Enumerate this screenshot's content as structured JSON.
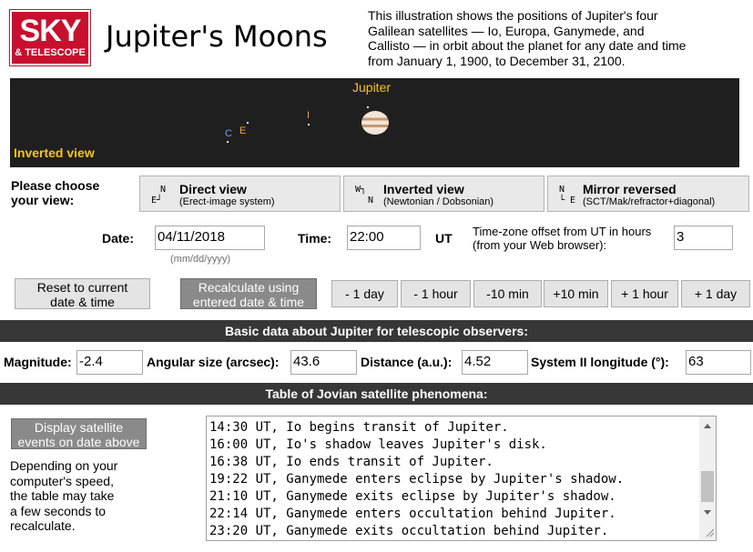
{
  "header": {
    "logo_top": "SKY",
    "logo_bottom": "& TELESCOPE",
    "title": "Jupiter's Moons",
    "intro": [
      "This illustration shows the positions of Jupiter's four",
      "Galilean satellites — Io, Europa, Ganymede, and",
      "Callisto — in orbit about the planet for any date and time",
      "from January 1, 1900, to December 31, 2100."
    ]
  },
  "sky_view": {
    "planet_label": "Jupiter",
    "view_label": "Inverted view",
    "moons": [
      {
        "letter": "C",
        "name": "Callisto",
        "color": "#6aa0ff"
      },
      {
        "letter": "E",
        "name": "Europa",
        "color": "#f5a623"
      },
      {
        "letter": "I",
        "name": "Io",
        "color": "#f5a623"
      }
    ]
  },
  "view_select": {
    "prompt_line1": "Please choose",
    "prompt_line2": "your view:",
    "options": [
      {
        "glyph_top": "N",
        "glyph_bottom": "E┘",
        "title": "Direct view",
        "sub": "(Erect-image system)"
      },
      {
        "glyph_top": "W┐",
        "glyph_bottom": "N",
        "title": "Inverted view",
        "sub": "(Newtonian / Dobsonian)"
      },
      {
        "glyph_top": "N",
        "glyph_bottom": "└ E",
        "title": "Mirror reversed",
        "sub": "(SCT/Mak/refractor+diagonal)"
      }
    ]
  },
  "datetime": {
    "date_label": "Date:",
    "date_value": "04/11/2018",
    "date_format": "(mm/dd/yyyy)",
    "time_label": "Time:",
    "time_value": "22:00",
    "ut_label": "UT",
    "tz_note_1": "Time-zone offset from UT in hours",
    "tz_note_2": "(from your Web browser):",
    "tz_value": "3"
  },
  "controls": {
    "reset_1": "Reset to current",
    "reset_2": "date & time",
    "recalc_1": "Recalculate using",
    "recalc_2": "entered date & time",
    "steps": [
      "- 1 day",
      "- 1 hour",
      "-10 min",
      "+10 min",
      "+ 1 hour",
      "+ 1 day"
    ]
  },
  "basic": {
    "heading": "Basic data about Jupiter for telescopic observers:",
    "magnitude_label": "Magnitude:",
    "magnitude_value": "-2.4",
    "angular_label": "Angular size (arcsec):",
    "angular_value": "43.6",
    "distance_label": "Distance (a.u.):",
    "distance_value": "4.52",
    "longitude_label": "System II longitude (°):",
    "longitude_value": "63"
  },
  "phenomena": {
    "heading": "Table of Jovian satellite phenomena:",
    "display_1": "Display satellite",
    "display_2": "events on date above",
    "note": [
      "Depending on your",
      "computer's speed,",
      "the table may take",
      "a few seconds to",
      "recalculate."
    ],
    "events": [
      "14:30 UT, Io begins transit of Jupiter.",
      "16:00 UT, Io's shadow leaves Jupiter's disk.",
      "16:38 UT, Io ends transit of Jupiter.",
      "19:22 UT, Ganymede enters eclipse by Jupiter's shadow.",
      "21:10 UT, Ganymede exits eclipse by Jupiter's shadow.",
      "22:14 UT, Ganymede enters occultation behind Jupiter.",
      "23:20 UT, Ganymede exits occultation behind Jupiter."
    ]
  }
}
